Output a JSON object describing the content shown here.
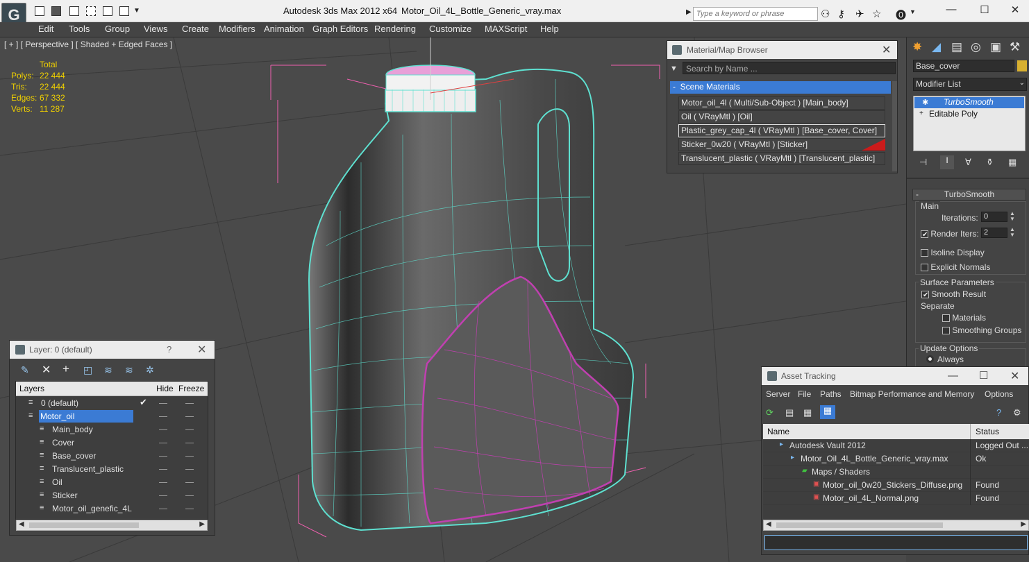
{
  "app": {
    "logo_glyph": "G",
    "title": "Autodesk 3ds Max  2012 x64",
    "file": "Motor_Oil_4L_Bottle_Generic_vray.max",
    "search_placeholder": "Type a keyword or phrase"
  },
  "menu": [
    "Edit",
    "Tools",
    "Group",
    "Views",
    "Create",
    "Modifiers",
    "Animation",
    "Graph Editors",
    "Rendering",
    "Customize",
    "MAXScript",
    "Help"
  ],
  "viewport": {
    "label": "[ + ] [ Perspective ] [ Shaded + Edged Faces ]",
    "stats_header": "Total",
    "stats": [
      {
        "label": "Polys:",
        "value": "22 444"
      },
      {
        "label": "Tris:",
        "value": "22 444"
      },
      {
        "label": "Edges:",
        "value": "67 332"
      },
      {
        "label": "Verts:",
        "value": "11 287"
      }
    ]
  },
  "material_browser": {
    "title": "Material/Map Browser",
    "search_placeholder": "Search by Name ...",
    "group": "Scene Materials",
    "group_toggle": "-",
    "items": [
      "Motor_oil_4l  ( Multi/Sub-Object ) [Main_body]",
      "Oil  ( VRayMtl ) [Oil]",
      "Plastic_grey_cap_4l  ( VRayMtl ) [Base_cover, Cover]",
      "Sticker_0w20  ( VRayMtl ) [Sticker]",
      "Translucent_plastic  ( VRayMtl ) [Translucent_plastic]"
    ]
  },
  "command_panel": {
    "object_name": "Base_cover",
    "modifier_list": "Modifier List",
    "stack": [
      "TurboSmooth",
      "Editable Poly"
    ],
    "rollout_title": "TurboSmooth",
    "rollout_toggle": "-",
    "main_label": "Main",
    "iterations_label": "Iterations:",
    "iterations_value": "0",
    "render_iters_label": "Render Iters:",
    "render_iters_value": "2",
    "isoline_label": "Isoline Display",
    "explicit_normals_label": "Explicit Normals",
    "surface_params_label": "Surface Parameters",
    "smooth_result_label": "Smooth Result",
    "separate_label": "Separate",
    "materials_label": "Materials",
    "smoothing_groups_label": "Smoothing Groups",
    "update_options_label": "Update Options",
    "always_label": "Always"
  },
  "layer_window": {
    "title": "Layer: 0 (default)",
    "help": "?",
    "col_layers": "Layers",
    "col_hide": "Hide",
    "col_freeze": "Freeze",
    "rows": [
      {
        "name": "0 (default)",
        "indent": 0,
        "check": "✔"
      },
      {
        "name": "Motor_oil",
        "indent": 0,
        "check": "",
        "selected": true
      },
      {
        "name": "Main_body",
        "indent": 1,
        "check": ""
      },
      {
        "name": "Cover",
        "indent": 1,
        "check": ""
      },
      {
        "name": "Base_cover",
        "indent": 1,
        "check": ""
      },
      {
        "name": "Translucent_plastic",
        "indent": 1,
        "check": ""
      },
      {
        "name": "Oil",
        "indent": 1,
        "check": ""
      },
      {
        "name": "Sticker",
        "indent": 1,
        "check": ""
      },
      {
        "name": "Motor_oil_genefic_4L",
        "indent": 1,
        "check": ""
      }
    ]
  },
  "asset_tracking": {
    "title": "Asset Tracking",
    "menu": [
      "Server",
      "File",
      "Paths",
      "Bitmap Performance and Memory",
      "Options"
    ],
    "col_name": "Name",
    "col_status": "Status",
    "rows": [
      {
        "name": "Autodesk Vault 2012",
        "status": "Logged Out ...",
        "indent": 1
      },
      {
        "name": "Motor_Oil_4L_Bottle_Generic_vray.max",
        "status": "Ok",
        "indent": 2
      },
      {
        "name": "Maps / Shaders",
        "status": "",
        "indent": 3
      },
      {
        "name": "Motor_oil_0w20_Stickers_Diffuse.png",
        "status": "Found",
        "indent": 4
      },
      {
        "name": "Motor_oil_4L_Normal.png",
        "status": "Found",
        "indent": 4
      }
    ]
  },
  "colors": {
    "accent": "#3b7bd4",
    "wire": "#5ee0d0",
    "sticker_wire": "#c040b0",
    "stat_text": "#f0d000",
    "selection_red": "#cc1b1b"
  }
}
